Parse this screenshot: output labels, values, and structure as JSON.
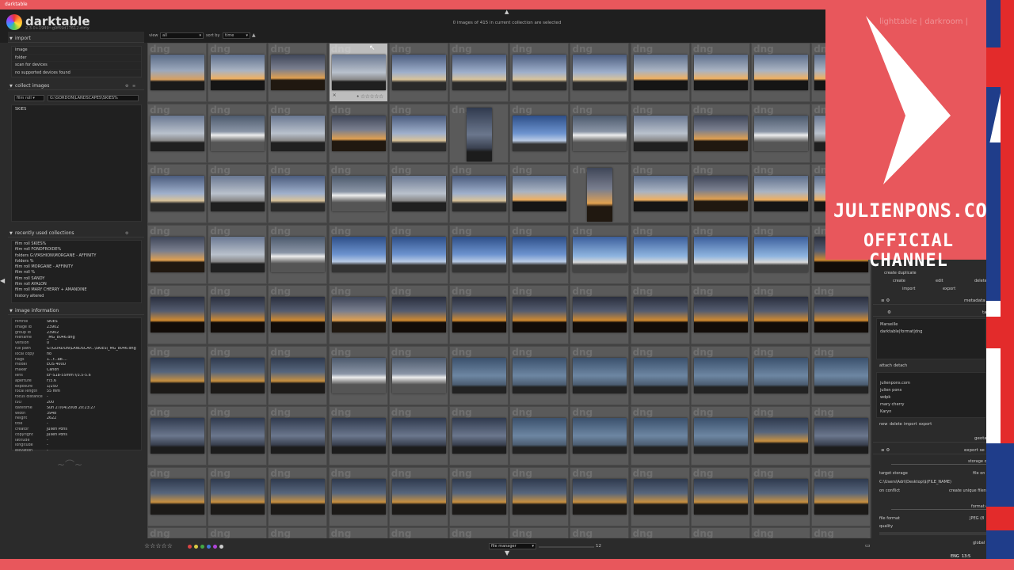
{
  "window_title": "darktable",
  "app": {
    "name": "darktable",
    "version": "2.3.0+1949~g9f69d17612-dirty"
  },
  "selection_info": "0 images of 415 in current collection are selected",
  "view_bar": {
    "view_label": "view",
    "view_value": "all",
    "sort_label": "sort by",
    "sort_value": "time"
  },
  "left_panel": {
    "import": {
      "title": "import",
      "buttons": [
        "image",
        "folder",
        "scan for devices",
        "no supported devices found"
      ]
    },
    "collect": {
      "title": "collect images",
      "property": "film roll",
      "value": "G:\\GORDON\\LANDSCAPES\\SKIES%",
      "items": [
        "SKIES"
      ]
    },
    "recent": {
      "title": "recently used collections",
      "items": [
        "film roll SKIES%",
        "film roll FONDFROIDE%",
        "folders G:\\FASHION\\MORGANE - AFFINITY",
        "folders %",
        "film roll MORGANE - AFFINITY",
        "film roll %",
        "film roll SANDY",
        "film roll AYALON",
        "film roll MARY CHERRY + AMANDINE",
        "history altered"
      ]
    },
    "info": {
      "title": "image information",
      "rows": [
        {
          "k": "filmroll",
          "v": "SKIES"
        },
        {
          "k": "image id",
          "v": "23902"
        },
        {
          "k": "group id",
          "v": "23902"
        },
        {
          "k": "filename",
          "v": "_MG_8046.dng"
        },
        {
          "k": "version",
          "v": "0"
        },
        {
          "k": "full path",
          "v": "G:\\GORDON\\LANDSCAP...\\SKIES\\_MG_8046.dng"
        },
        {
          "k": "local copy",
          "v": "no"
        },
        {
          "k": "flags",
          "v": "1...r...ab...."
        },
        {
          "k": "model",
          "v": "EOS 400D"
        },
        {
          "k": "maker",
          "v": "Canon"
        },
        {
          "k": "lens",
          "v": "EF-S18-55mm f/3.5-5.6"
        },
        {
          "k": "aperture",
          "v": "F/5.6"
        },
        {
          "k": "exposure",
          "v": "1/250"
        },
        {
          "k": "focal length",
          "v": "55 mm"
        },
        {
          "k": "focus distance",
          "v": "-"
        },
        {
          "k": "ISO",
          "v": "200"
        },
        {
          "k": "datetime",
          "v": "Sun 27/04/2008 20:23:27"
        },
        {
          "k": "width",
          "v": "3948"
        },
        {
          "k": "height",
          "v": "2622"
        },
        {
          "k": "title",
          "v": "-"
        },
        {
          "k": "creator",
          "v": "Julien Pons"
        },
        {
          "k": "copyright",
          "v": "Julien Pons"
        },
        {
          "k": "latitude",
          "v": "-"
        },
        {
          "k": "longitude",
          "v": "-"
        },
        {
          "k": "elevation",
          "v": "-"
        }
      ]
    }
  },
  "grid": {
    "watermark": "dng",
    "columns": 12,
    "zoom": "12"
  },
  "bottom": {
    "stars": "☆☆☆☆☆",
    "layout_value": "file manager",
    "zoom": "12",
    "label_colors": [
      "#d94444",
      "#d9c944",
      "#44a844",
      "#4477d9",
      "#b044d9",
      "#cccccc"
    ]
  },
  "right_panel": {
    "tabs": "lighttable | darkroom |",
    "selected_images": {
      "create_duplicate": "create duplicate",
      "create": "create",
      "edit": "edit",
      "delete": "delete",
      "import": "import",
      "export": "export"
    },
    "metadata_title": "metadata",
    "tagging_title": "ta",
    "attached_tags": [
      "Marseille",
      "darktable|format|dng"
    ],
    "attach": "attach",
    "detach": "detach",
    "dictionary_tags": [
      "julienpons.com",
      "julien pons",
      "wdpk",
      "mary cherry",
      "Karyn"
    ],
    "tag_actions": [
      "new",
      "delete",
      "import",
      "export"
    ],
    "geotag_title": "geota",
    "export_title": "export se",
    "storage_label": "storage o",
    "target_storage": "target storage",
    "file_on": "file on",
    "export_path": "C:\\Users\\Adri\\Desktop\\$(FILE_NAME)",
    "on_conflict": "on conflict",
    "conflict_value": "create unique filena",
    "format_label": "format o",
    "file_format": "file format",
    "file_format_value": "JPEG (8",
    "quality": "quality",
    "global": "global o"
  },
  "overlay": {
    "brand_line1": "JULIENPONS.COM",
    "brand_line2": "OFFICIAL CHANNEL"
  },
  "tray": {
    "lang": "ENG",
    "time": "13:5"
  }
}
